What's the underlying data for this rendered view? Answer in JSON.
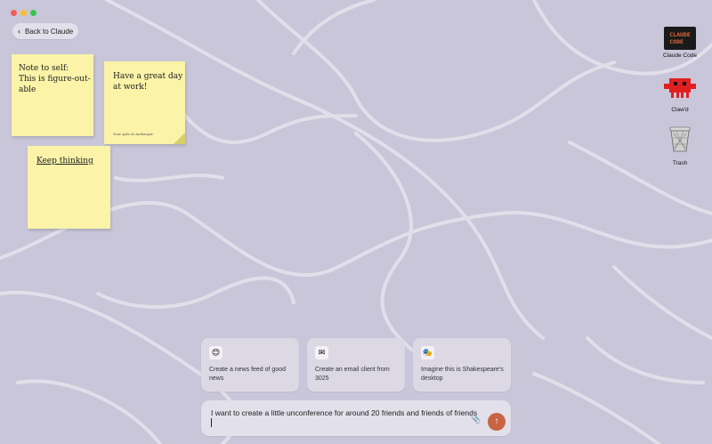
{
  "window": {
    "traffic_lights": [
      "#ee5f57",
      "#f7bf2f",
      "#36c64b"
    ]
  },
  "back_button": {
    "label": "Back to Claude"
  },
  "notes": [
    {
      "text": "Note to self:\nThis is figure-out-\nable"
    },
    {
      "text": "Have a great day\nat work!",
      "signature": "Your pals at Anthropic"
    },
    {
      "text": "Keep thinking"
    }
  ],
  "desktop_icons": [
    {
      "label": "Claude Code",
      "icon": "claude-code-terminal-icon",
      "glyph": "CLAUDE\nCODE"
    },
    {
      "label": "Claw'd",
      "icon": "crab-mascot-icon"
    },
    {
      "label": "Trash",
      "icon": "trash-can-icon"
    }
  ],
  "suggestions": [
    {
      "icon": "smiley-face-icon",
      "glyph": "😊",
      "text": "Create a news feed of good news"
    },
    {
      "icon": "envelope-icon",
      "glyph": "✉",
      "text": "Create an email client from 3025"
    },
    {
      "icon": "shakespeare-portrait-icon",
      "glyph": "🎭",
      "text": "Imagine this is Shakespeare's desktop"
    }
  ],
  "prompt": {
    "value": "I want to create a little unconference for around 20 friends and friends of friends",
    "attach_icon": "paperclip-icon",
    "send_icon": "arrow-up-icon"
  },
  "colors": {
    "background": "#c9c6d9",
    "note": "#faf3a8",
    "accent": "#c96442"
  }
}
